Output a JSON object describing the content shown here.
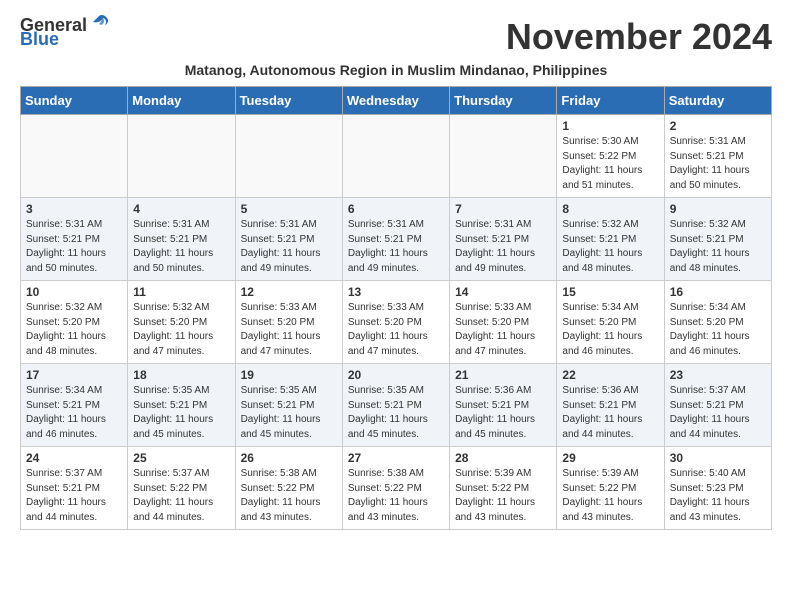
{
  "header": {
    "logo_general": "General",
    "logo_blue": "Blue",
    "month_title": "November 2024",
    "subtitle": "Matanog, Autonomous Region in Muslim Mindanao, Philippines"
  },
  "days_of_week": [
    "Sunday",
    "Monday",
    "Tuesday",
    "Wednesday",
    "Thursday",
    "Friday",
    "Saturday"
  ],
  "weeks": [
    [
      {
        "day": "",
        "info": ""
      },
      {
        "day": "",
        "info": ""
      },
      {
        "day": "",
        "info": ""
      },
      {
        "day": "",
        "info": ""
      },
      {
        "day": "",
        "info": ""
      },
      {
        "day": "1",
        "info": "Sunrise: 5:30 AM\nSunset: 5:22 PM\nDaylight: 11 hours\nand 51 minutes."
      },
      {
        "day": "2",
        "info": "Sunrise: 5:31 AM\nSunset: 5:21 PM\nDaylight: 11 hours\nand 50 minutes."
      }
    ],
    [
      {
        "day": "3",
        "info": "Sunrise: 5:31 AM\nSunset: 5:21 PM\nDaylight: 11 hours\nand 50 minutes."
      },
      {
        "day": "4",
        "info": "Sunrise: 5:31 AM\nSunset: 5:21 PM\nDaylight: 11 hours\nand 50 minutes."
      },
      {
        "day": "5",
        "info": "Sunrise: 5:31 AM\nSunset: 5:21 PM\nDaylight: 11 hours\nand 49 minutes."
      },
      {
        "day": "6",
        "info": "Sunrise: 5:31 AM\nSunset: 5:21 PM\nDaylight: 11 hours\nand 49 minutes."
      },
      {
        "day": "7",
        "info": "Sunrise: 5:31 AM\nSunset: 5:21 PM\nDaylight: 11 hours\nand 49 minutes."
      },
      {
        "day": "8",
        "info": "Sunrise: 5:32 AM\nSunset: 5:21 PM\nDaylight: 11 hours\nand 48 minutes."
      },
      {
        "day": "9",
        "info": "Sunrise: 5:32 AM\nSunset: 5:21 PM\nDaylight: 11 hours\nand 48 minutes."
      }
    ],
    [
      {
        "day": "10",
        "info": "Sunrise: 5:32 AM\nSunset: 5:20 PM\nDaylight: 11 hours\nand 48 minutes."
      },
      {
        "day": "11",
        "info": "Sunrise: 5:32 AM\nSunset: 5:20 PM\nDaylight: 11 hours\nand 47 minutes."
      },
      {
        "day": "12",
        "info": "Sunrise: 5:33 AM\nSunset: 5:20 PM\nDaylight: 11 hours\nand 47 minutes."
      },
      {
        "day": "13",
        "info": "Sunrise: 5:33 AM\nSunset: 5:20 PM\nDaylight: 11 hours\nand 47 minutes."
      },
      {
        "day": "14",
        "info": "Sunrise: 5:33 AM\nSunset: 5:20 PM\nDaylight: 11 hours\nand 47 minutes."
      },
      {
        "day": "15",
        "info": "Sunrise: 5:34 AM\nSunset: 5:20 PM\nDaylight: 11 hours\nand 46 minutes."
      },
      {
        "day": "16",
        "info": "Sunrise: 5:34 AM\nSunset: 5:20 PM\nDaylight: 11 hours\nand 46 minutes."
      }
    ],
    [
      {
        "day": "17",
        "info": "Sunrise: 5:34 AM\nSunset: 5:21 PM\nDaylight: 11 hours\nand 46 minutes."
      },
      {
        "day": "18",
        "info": "Sunrise: 5:35 AM\nSunset: 5:21 PM\nDaylight: 11 hours\nand 45 minutes."
      },
      {
        "day": "19",
        "info": "Sunrise: 5:35 AM\nSunset: 5:21 PM\nDaylight: 11 hours\nand 45 minutes."
      },
      {
        "day": "20",
        "info": "Sunrise: 5:35 AM\nSunset: 5:21 PM\nDaylight: 11 hours\nand 45 minutes."
      },
      {
        "day": "21",
        "info": "Sunrise: 5:36 AM\nSunset: 5:21 PM\nDaylight: 11 hours\nand 45 minutes."
      },
      {
        "day": "22",
        "info": "Sunrise: 5:36 AM\nSunset: 5:21 PM\nDaylight: 11 hours\nand 44 minutes."
      },
      {
        "day": "23",
        "info": "Sunrise: 5:37 AM\nSunset: 5:21 PM\nDaylight: 11 hours\nand 44 minutes."
      }
    ],
    [
      {
        "day": "24",
        "info": "Sunrise: 5:37 AM\nSunset: 5:21 PM\nDaylight: 11 hours\nand 44 minutes."
      },
      {
        "day": "25",
        "info": "Sunrise: 5:37 AM\nSunset: 5:22 PM\nDaylight: 11 hours\nand 44 minutes."
      },
      {
        "day": "26",
        "info": "Sunrise: 5:38 AM\nSunset: 5:22 PM\nDaylight: 11 hours\nand 43 minutes."
      },
      {
        "day": "27",
        "info": "Sunrise: 5:38 AM\nSunset: 5:22 PM\nDaylight: 11 hours\nand 43 minutes."
      },
      {
        "day": "28",
        "info": "Sunrise: 5:39 AM\nSunset: 5:22 PM\nDaylight: 11 hours\nand 43 minutes."
      },
      {
        "day": "29",
        "info": "Sunrise: 5:39 AM\nSunset: 5:22 PM\nDaylight: 11 hours\nand 43 minutes."
      },
      {
        "day": "30",
        "info": "Sunrise: 5:40 AM\nSunset: 5:23 PM\nDaylight: 11 hours\nand 43 minutes."
      }
    ]
  ]
}
